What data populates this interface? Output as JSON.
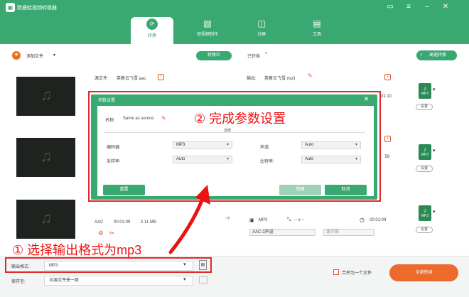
{
  "app": {
    "title": "数据蛙视频转换器"
  },
  "tabs": [
    {
      "label": "转换"
    },
    {
      "label": "短视频制作"
    },
    {
      "label": "分屏"
    },
    {
      "label": "工具"
    }
  ],
  "toolbar": {
    "add_file": "添加文件",
    "converting": "转换中",
    "converted": "已转换",
    "high_speed": "高速转换"
  },
  "file1": {
    "src_label": "源文件:",
    "src_name": "笑着云飞雪.aac",
    "out_label": "输出:",
    "out_name": "笑着云飞雪.mp3",
    "time": "01:10",
    "fmt": "MP3",
    "settings": "设置"
  },
  "file2": {
    "time": ":58",
    "fmt": "MP3",
    "settings": "设置"
  },
  "file3": {
    "codec": "AAC",
    "duration": "00:01:09",
    "size": "2.11 MB",
    "out_fmt": "MP3",
    "out_res": "-- x --",
    "out_time": "00:01:09",
    "channel": "AAC-2声道",
    "subtitle": "源字幕",
    "fmt": "MP3",
    "settings": "设置"
  },
  "dialog": {
    "title": "参数设置",
    "name_label": "名称:",
    "name_value": "Same as source",
    "section": "音频",
    "encoder_label": "编码器:",
    "encoder_value": "MP3",
    "samplerate_label": "采样率:",
    "samplerate_value": "Auto",
    "channel_label": "声道:",
    "channel_value": "Auto",
    "bitrate_label": "比特率:",
    "bitrate_value": "Auto",
    "reset": "重置",
    "save": "新建",
    "cancel": "取消"
  },
  "annotations": {
    "step1": "① 选择输出格式为mp3",
    "step2": "② 完成参数设置"
  },
  "footer": {
    "output_format_label": "输出格式:",
    "output_format_value": "MP3",
    "save_to_label": "保存至:",
    "save_to_value": "与源文件夹一致",
    "merge_label": "合并为一个文件",
    "convert_all": "全部转换"
  },
  "colors": {
    "brand": "#3aa871",
    "accent": "#ec6a2c",
    "annotation": "#e02828"
  }
}
